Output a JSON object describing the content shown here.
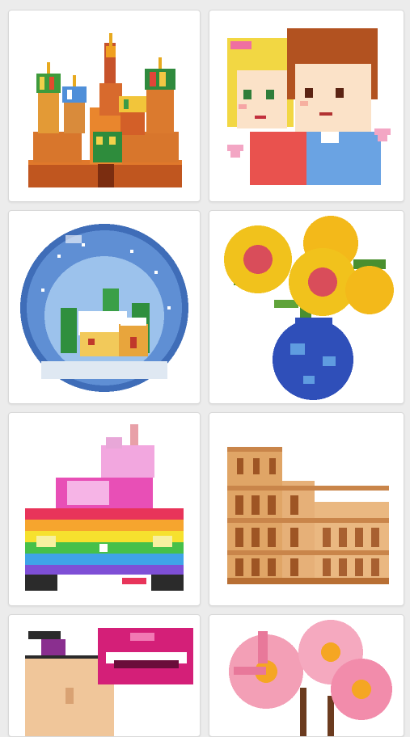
{
  "gallery": {
    "columns": 2,
    "artworks": [
      {
        "subject": "cathedral-onion-domes",
        "icon": "cathedral-icon"
      },
      {
        "subject": "cartoon-couple-with-hearts",
        "icon": "couple-icon"
      },
      {
        "subject": "snow-globe-house",
        "icon": "snow-globe-icon"
      },
      {
        "subject": "sunflowers-in-blue-vase",
        "icon": "sunflower-vase-icon"
      },
      {
        "subject": "rainbow-car-with-unicorn",
        "icon": "rainbow-car-icon"
      },
      {
        "subject": "colosseum",
        "icon": "colosseum-icon"
      },
      {
        "subject": "hand-holding-lips-lollipop",
        "icon": "lips-lollipop-icon"
      },
      {
        "subject": "pink-daisies",
        "icon": "pink-flowers-icon"
      }
    ]
  },
  "colors": {
    "background": "#ececec",
    "card": "#ffffff",
    "card_border": "#d9d9d9"
  }
}
